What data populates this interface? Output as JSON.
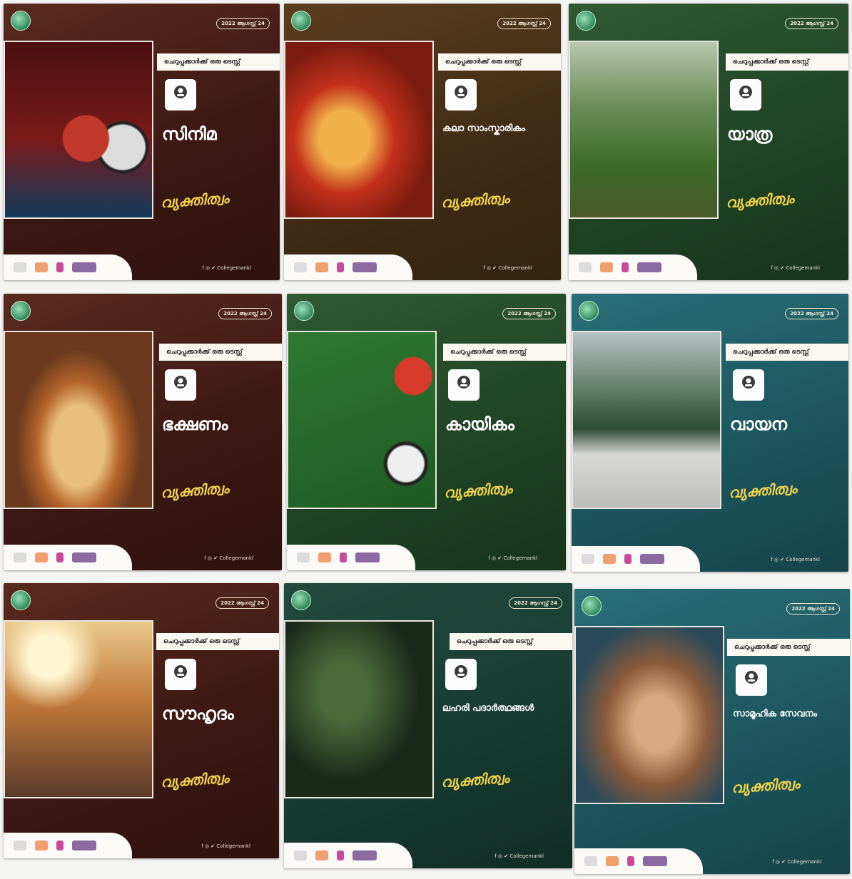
{
  "posters": [
    {
      "theme": "brown",
      "title": "സിനിമ",
      "date": "2022 ആഗസ്റ്റ് 24",
      "ribbon": "ചെറുപ്പക്കാർക്ക് ഒരു ടെസ്റ്റ്",
      "badge": "cinema-icon"
    },
    {
      "theme": "olive",
      "title": "കലാ സാംസ്കാരികം",
      "date": "2022 ആഗസ്റ്റ് 24",
      "ribbon": "ചെറുപ്പക്കാർക്ക് ഒരു ടെസ്റ്റ്",
      "badge": "arts-icon"
    },
    {
      "theme": "green",
      "title": "യാത്ര",
      "date": "2022 ആഗസ്റ്റ് 24",
      "ribbon": "ചെറുപ്പക്കാർക്ക് ഒരു ടെസ്റ്റ്",
      "badge": "travel-icon"
    },
    {
      "theme": "brown",
      "title": "ഭക്ഷണം",
      "date": "2022 ആഗസ്റ്റ് 24",
      "ribbon": "ചെറുപ്പക്കാർക്ക് ഒരു ടെസ്റ്റ്",
      "badge": "food-icon"
    },
    {
      "theme": "green",
      "title": "കായികം",
      "date": "2022 ആഗസ്റ്റ് 24",
      "ribbon": "ചെറുപ്പക്കാർക്ക് ഒരു ടെസ്റ്റ്",
      "badge": "sports-icon"
    },
    {
      "theme": "teal",
      "title": "വായന",
      "date": "2022 ആഗസ്റ്റ് 24",
      "ribbon": "ചെറുപ്പക്കാർക്ക് ഒരു ടെസ്റ്റ്",
      "badge": "reading-icon"
    },
    {
      "theme": "brown",
      "title": "സൗഹൃദം",
      "date": "2022 ആഗസ്റ്റ് 24",
      "ribbon": "ചെറുപ്പക്കാർക്ക് ഒരു ടെസ്റ്റ്",
      "badge": "friendship-icon"
    },
    {
      "theme": "darkgreen",
      "title": "ലഹരി പദാർത്ഥങ്ങൾ",
      "date": "2022 ആഗസ്റ്റ് 24",
      "ribbon": "ചെറുപ്പക്കാർക്ക് ഒരു ടെസ്റ്റ്",
      "badge": "substance-icon"
    },
    {
      "theme": "teal",
      "title": "സാമൂഹിക സേവനം",
      "date": "2022 ആഗസ്റ്റ് 24",
      "ribbon": "ചെറുപ്പക്കാർക്ക് ഒരു ടെസ്റ്റ്",
      "badge": "service-icon"
    }
  ],
  "common": {
    "signature": "വ്യക്തിത്വം",
    "social_handle": "f ◎ ✔ Collegemankl"
  },
  "colors": {
    "brown": "#3a1712",
    "olive": "#3f2b16",
    "green": "#1f4224",
    "teal": "#1c545c",
    "darkgreen": "#173a30",
    "signature": "#f2d34a"
  }
}
